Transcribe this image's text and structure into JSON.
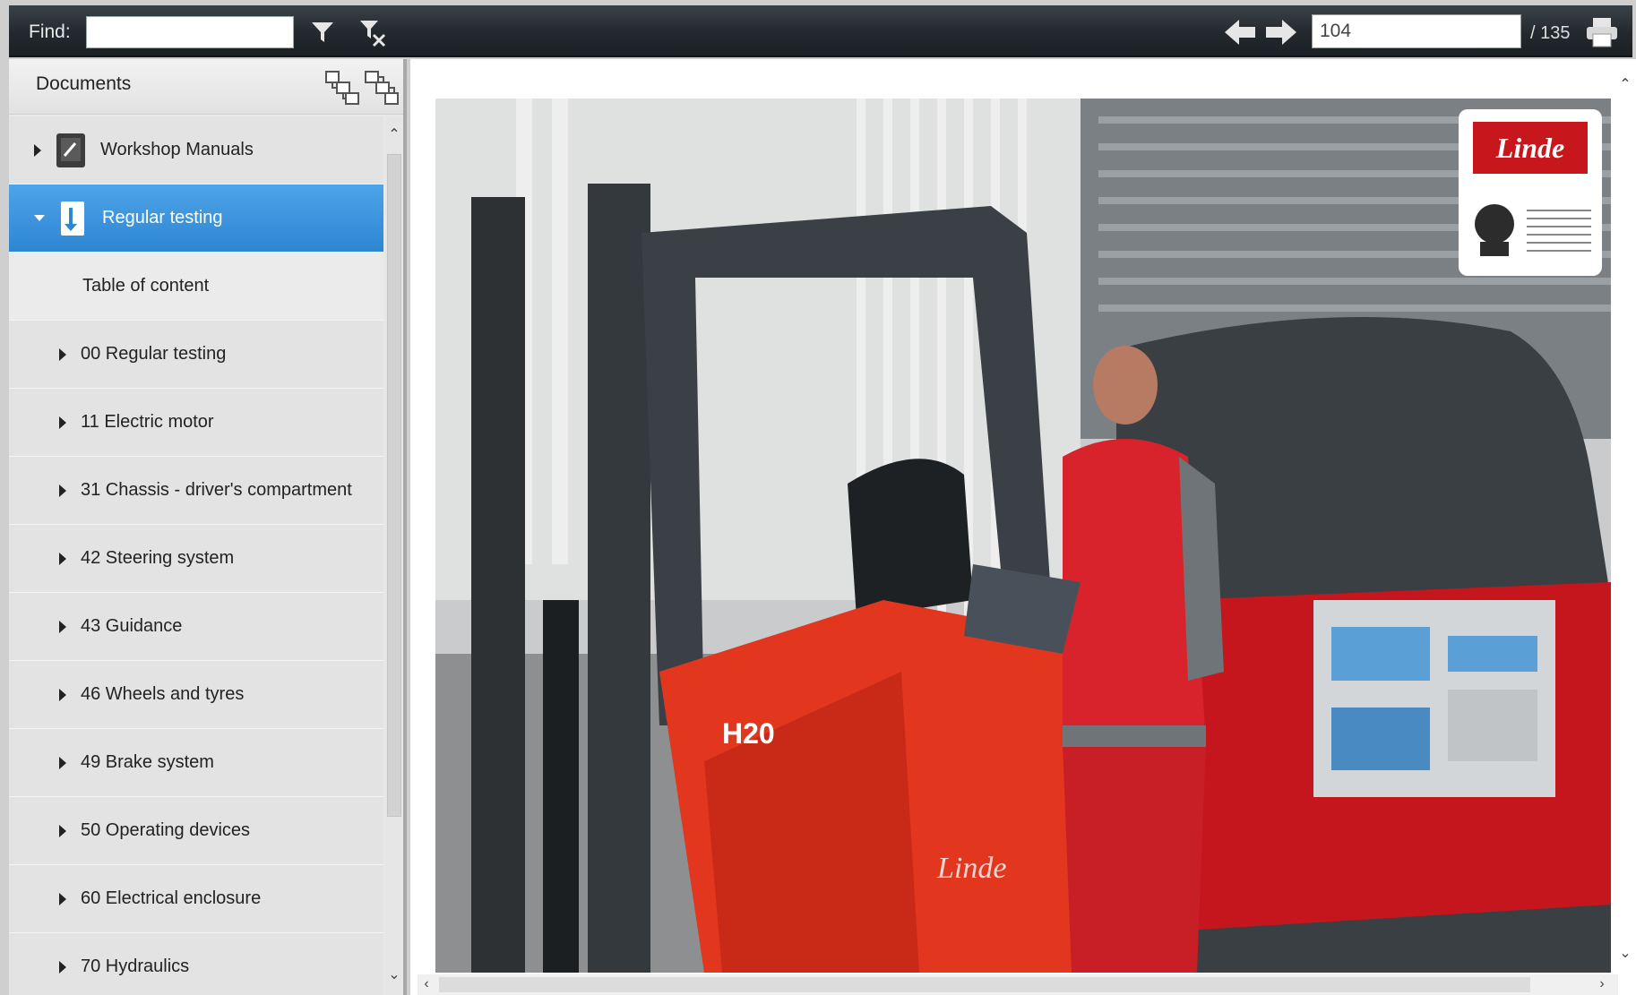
{
  "toolbar": {
    "find_label": "Find:",
    "find_value": "",
    "page_current": "104",
    "page_total": "/ 135",
    "icons": [
      "filter-icon",
      "clear-filter-icon",
      "back-arrow-icon",
      "forward-arrow-icon",
      "print-icon"
    ]
  },
  "sidebar": {
    "title": "Documents",
    "header_icons": [
      "expand-all-icon",
      "collapse-all-icon"
    ],
    "items": [
      {
        "label": "Workshop Manuals",
        "state": "collapsed"
      },
      {
        "label": "Regular testing",
        "state": "expanded-selected"
      },
      {
        "label": "Table of content"
      },
      {
        "label": "00 Regular testing"
      },
      {
        "label": "11 Electric motor"
      },
      {
        "label": "31 Chassis - driver's compartment"
      },
      {
        "label": "42 Steering system"
      },
      {
        "label": "43 Guidance"
      },
      {
        "label": "46 Wheels and tyres"
      },
      {
        "label": "49 Brake system"
      },
      {
        "label": "50 Operating devices"
      },
      {
        "label": "60 Electrical enclosure"
      },
      {
        "label": "70 Hydraulics"
      }
    ]
  },
  "document": {
    "brand": "Linde",
    "truck_badge": "H20",
    "colors": {
      "brand_red": "#c8161d",
      "toolbar": "#23292e",
      "selection": "#2e86d3"
    }
  }
}
